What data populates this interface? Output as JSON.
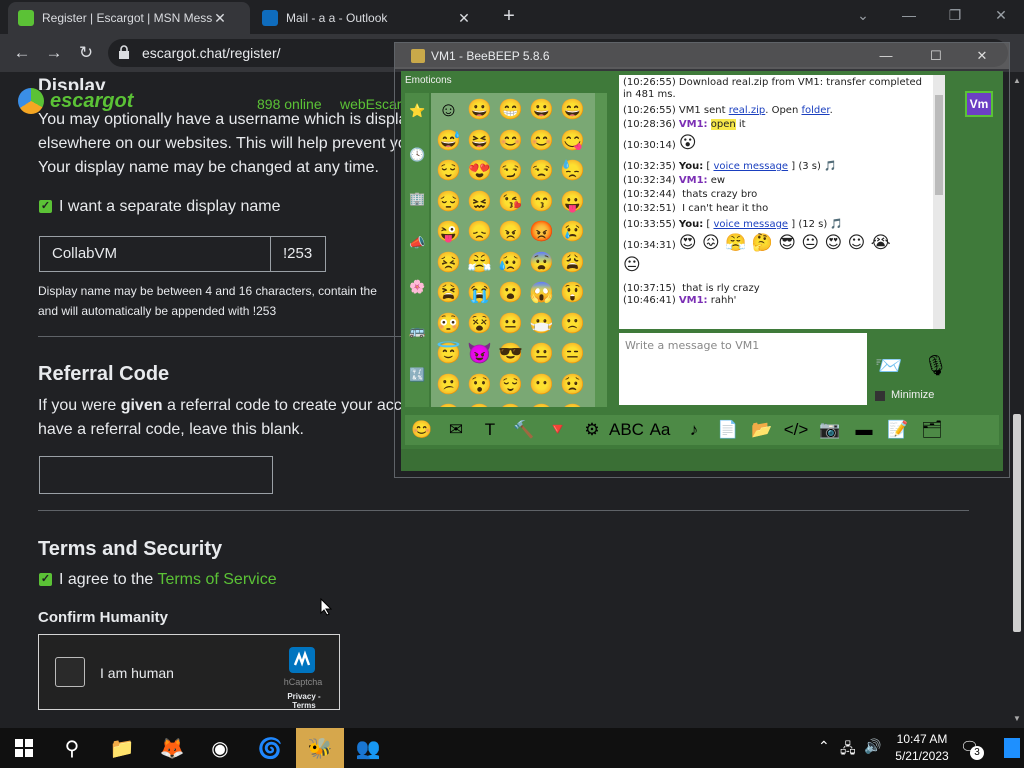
{
  "browser": {
    "tabs": [
      {
        "title": "Register | Escargot | MSN Messenger",
        "active": true,
        "favicon_color": "#5bc236"
      },
      {
        "title": "Mail - a a - Outlook",
        "active": false,
        "favicon_color": "#0f6cbd"
      }
    ],
    "url": "escargot.chat/register/"
  },
  "page": {
    "logo_text": "escargot",
    "online_count": "898 online",
    "web_escargot": "webEscargot",
    "display_heading": "Display",
    "display_para_1": "You may optionally have a username which is displayed",
    "display_para_2": "elsewhere on our websites. This will help prevent your",
    "display_para_3": "Your display name may be changed at any time.",
    "separate_display_label": "I want a separate display name",
    "display_name_value": "CollabVM",
    "display_suffix": "!253",
    "display_rule_1": "Display name may be between 4 and 16 characters, contain the",
    "display_rule_2": "and will automatically be appended with !253",
    "referral_heading": "Referral Code",
    "referral_para_1a": "If you were ",
    "referral_para_1b": "given",
    "referral_para_1c": " a referral code to create your acco",
    "referral_para_2": "have a referral code, leave this blank.",
    "referral_value": "",
    "terms_heading": "Terms and Security",
    "agree_label": "I agree to the ",
    "tos_link": "Terms of Service",
    "humanity_heading": "Confirm Humanity",
    "captcha_label": "I am human",
    "captcha_brand": "hCaptcha",
    "captcha_links": "Privacy - Terms"
  },
  "beebeep": {
    "title": "VM1 - BeeBEEP 5.8.6",
    "emoticons_label": "Emoticons",
    "emoticons": [
      "☺",
      "😀",
      "😁",
      "😀",
      "😄",
      "😅",
      "😆",
      "😊",
      "😊",
      "😋",
      "😌",
      "😍",
      "😏",
      "😒",
      "😓",
      "😔",
      "😖",
      "😘",
      "😙",
      "😛",
      "😜",
      "😞",
      "😠",
      "😡",
      "😢",
      "😣",
      "😤",
      "😥",
      "😨",
      "😩",
      "😫",
      "😭",
      "😮",
      "😱",
      "😲",
      "😳",
      "😵",
      "😐",
      "😷",
      "🙁",
      "😇",
      "😈",
      "😎",
      "😐",
      "😑",
      "😕",
      "😯",
      "😌",
      "😶",
      "😟",
      "😶",
      "😧",
      "😬",
      "😵",
      "😦"
    ],
    "messages": [
      {
        "time": "(10:26:55)",
        "text": "Download real.zip from VM1: transfer completed in 481 ms."
      },
      {
        "time": "(10:26:55)",
        "text": "VM1 sent ",
        "link": "real.zip",
        "text2": ". Open ",
        "link2": "folder",
        "text3": "."
      },
      {
        "time": "(10:28:36)",
        "who": "VM1:",
        "highlight": "open",
        "text": " it"
      },
      {
        "time": "(10:30:14)",
        "emoji": "😮"
      },
      {
        "time": "(10:32:35)",
        "who_you": "You:",
        "text": " [ ",
        "link": "voice message",
        "text2": " ] (3 s) 🎵"
      },
      {
        "time": "(10:32:34)",
        "who": "VM1:",
        "text": " ew"
      },
      {
        "time": "(10:32:44)",
        "text": "thats crazy bro"
      },
      {
        "time": "(10:32:51)",
        "text": "I can't hear it tho"
      },
      {
        "time": "(10:33:55)",
        "who_you": "You:",
        "text": " [ ",
        "link": "voice message",
        "text2": " ] (12 s) 🎵"
      },
      {
        "time": "(10:34:31)",
        "emoji": "😍 😖 😤 🤔 😎 😐 😍 ☺ 😭"
      },
      {
        "time": "",
        "emoji": "😐"
      },
      {
        "time": "(10:37:15)",
        "text": "that is rly crazy"
      },
      {
        "time": "(10:46:41)",
        "who": "VM1:",
        "text": " rahh'"
      }
    ],
    "input_placeholder": "Write a message to VM1",
    "minimize_label": "Minimize",
    "vm_badge": "Vm",
    "toolbar_icons": [
      "😊",
      "✉",
      "T",
      "🔨",
      "🔻",
      "⚙",
      "ABC",
      "Aa",
      "♪",
      "📄",
      "📂",
      "</>",
      "📷",
      "▬",
      "📝",
      "🗂"
    ]
  },
  "taskbar": {
    "clock_time": "10:47 AM",
    "clock_date": "5/21/2023",
    "notification_count": "3"
  }
}
